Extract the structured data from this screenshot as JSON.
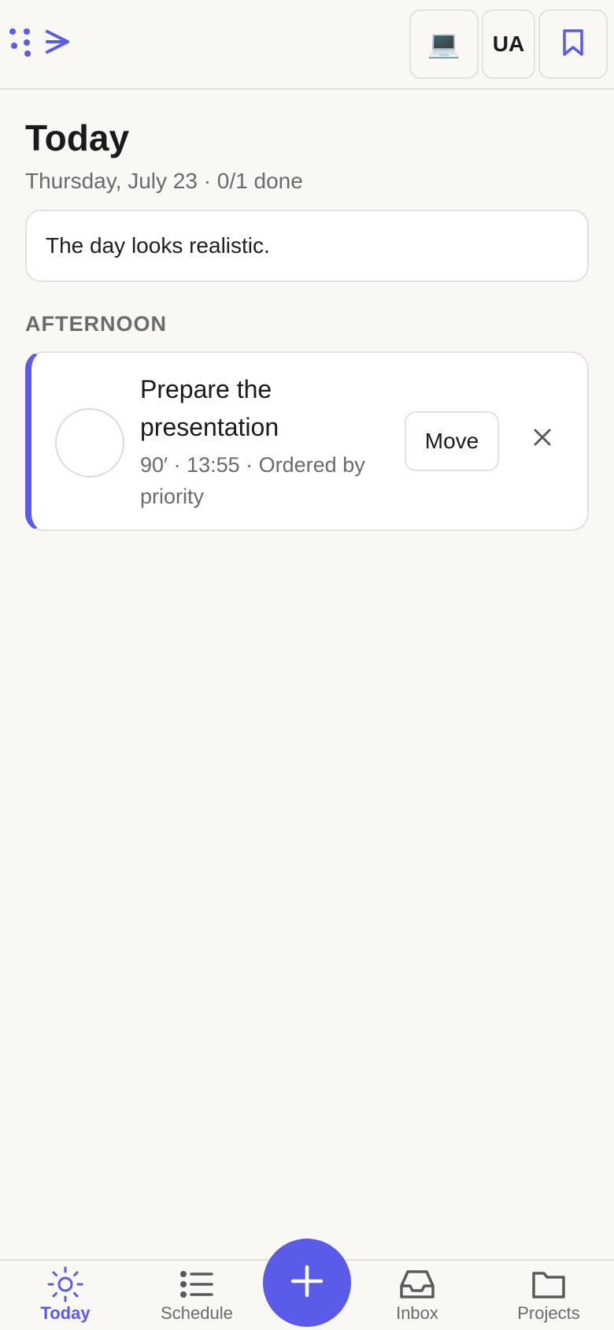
{
  "topbar": {
    "logo_icon": "planner-logo-icon",
    "device_button_glyph": "💻",
    "language_label": "UA",
    "bookmark_icon": "bookmark-icon"
  },
  "header": {
    "title": "Today",
    "subtitle": "Thursday, July 23 · 0/1 done"
  },
  "hint": "The day looks realistic.",
  "sections": [
    {
      "label": "AFTERNOON",
      "tasks": [
        {
          "title": "Prepare the presentation",
          "meta": "90′ · 13:55 · Ordered by priority",
          "move_label": "Move",
          "done": false
        }
      ]
    }
  ],
  "nav": {
    "items": [
      {
        "label": "Today",
        "icon": "sun-icon",
        "active": true
      },
      {
        "label": "Schedule",
        "icon": "list-icon",
        "active": false
      },
      {
        "label": "Inbox",
        "icon": "inbox-icon",
        "active": false
      },
      {
        "label": "Projects",
        "icon": "folder-icon",
        "active": false
      }
    ],
    "add_icon": "plus-icon"
  },
  "colors": {
    "accent": "#5b5bea",
    "background": "#f9f8f5",
    "muted_text": "#6b6b6b"
  }
}
